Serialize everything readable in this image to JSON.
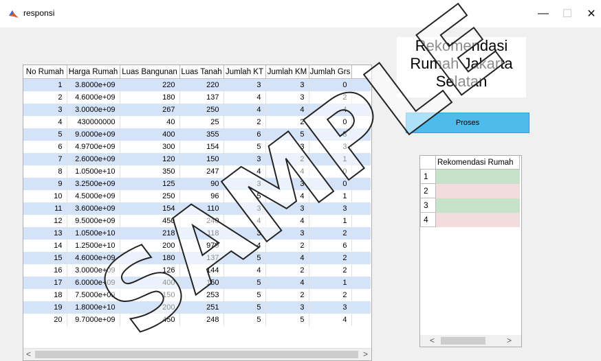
{
  "window": {
    "title": "responsi",
    "minimize_glyph": "—",
    "maximize_glyph": "☐",
    "close_glyph": "✕"
  },
  "title_panel": {
    "lines": [
      "Rekomendasi",
      "Rumah Jakarta",
      "Selatan"
    ]
  },
  "proses_button": {
    "label": "Proses"
  },
  "main_table": {
    "columns": [
      "No Rumah",
      "Harga Rumah",
      "Luas Bangunan",
      "Luas Tanah",
      "Jumlah KT",
      "Jumlah KM",
      "Jumlah Grs"
    ],
    "rows": [
      [
        "1",
        "3.8000e+09",
        "220",
        "220",
        "3",
        "3",
        "0"
      ],
      [
        "2",
        "4.6000e+09",
        "180",
        "137",
        "4",
        "3",
        "2"
      ],
      [
        "3",
        "3.0000e+09",
        "267",
        "250",
        "4",
        "4",
        "4"
      ],
      [
        "4",
        "430000000",
        "40",
        "25",
        "2",
        "2",
        "0"
      ],
      [
        "5",
        "9.0000e+09",
        "400",
        "355",
        "6",
        "5",
        "3"
      ],
      [
        "6",
        "4.9700e+09",
        "300",
        "154",
        "5",
        "3",
        "3"
      ],
      [
        "7",
        "2.6000e+09",
        "120",
        "150",
        "3",
        "2",
        "1"
      ],
      [
        "8",
        "1.0500e+10",
        "350",
        "247",
        "4",
        "4",
        "0"
      ],
      [
        "9",
        "3.2500e+09",
        "125",
        "90",
        "3",
        "3",
        "0"
      ],
      [
        "10",
        "4.5000e+09",
        "250",
        "96",
        "5",
        "4",
        "1"
      ],
      [
        "11",
        "3.6000e+09",
        "154",
        "110",
        "3",
        "3",
        "3"
      ],
      [
        "12",
        "9.5000e+09",
        "450",
        "240",
        "4",
        "4",
        "1"
      ],
      [
        "13",
        "1.0500e+10",
        "218",
        "118",
        "3",
        "3",
        "2"
      ],
      [
        "14",
        "1.2500e+10",
        "200",
        "979",
        "4",
        "2",
        "6"
      ],
      [
        "15",
        "4.6000e+09",
        "180",
        "137",
        "5",
        "4",
        "2"
      ],
      [
        "16",
        "3.0000e+09",
        "126",
        "144",
        "4",
        "2",
        "2"
      ],
      [
        "17",
        "6.0000e+09",
        "400",
        "150",
        "5",
        "4",
        "1"
      ],
      [
        "18",
        "7.5000e+09",
        "150",
        "253",
        "5",
        "2",
        "2"
      ],
      [
        "19",
        "1.8000e+10",
        "200",
        "251",
        "5",
        "3",
        "3"
      ],
      [
        "20",
        "9.7000e+09",
        "450",
        "248",
        "5",
        "5",
        "4"
      ]
    ],
    "scroll_left_glyph": "<",
    "scroll_right_glyph": ">"
  },
  "rekomendasi_table": {
    "header": "Rekomendasi Rumah",
    "rows": [
      {
        "num": "1",
        "value": "",
        "color": "#c6e2c8"
      },
      {
        "num": "2",
        "value": "",
        "color": "#f2dcde"
      },
      {
        "num": "3",
        "value": "",
        "color": "#c6e2c8"
      },
      {
        "num": "4",
        "value": "",
        "color": "#f2dcde"
      }
    ],
    "scroll_left_glyph": "<",
    "scroll_right_glyph": ">"
  },
  "watermark": {
    "text": "SAMPLE"
  },
  "colors": {
    "stripe_blue": "#d4e3f7",
    "button_blue": "#4dbbec"
  }
}
